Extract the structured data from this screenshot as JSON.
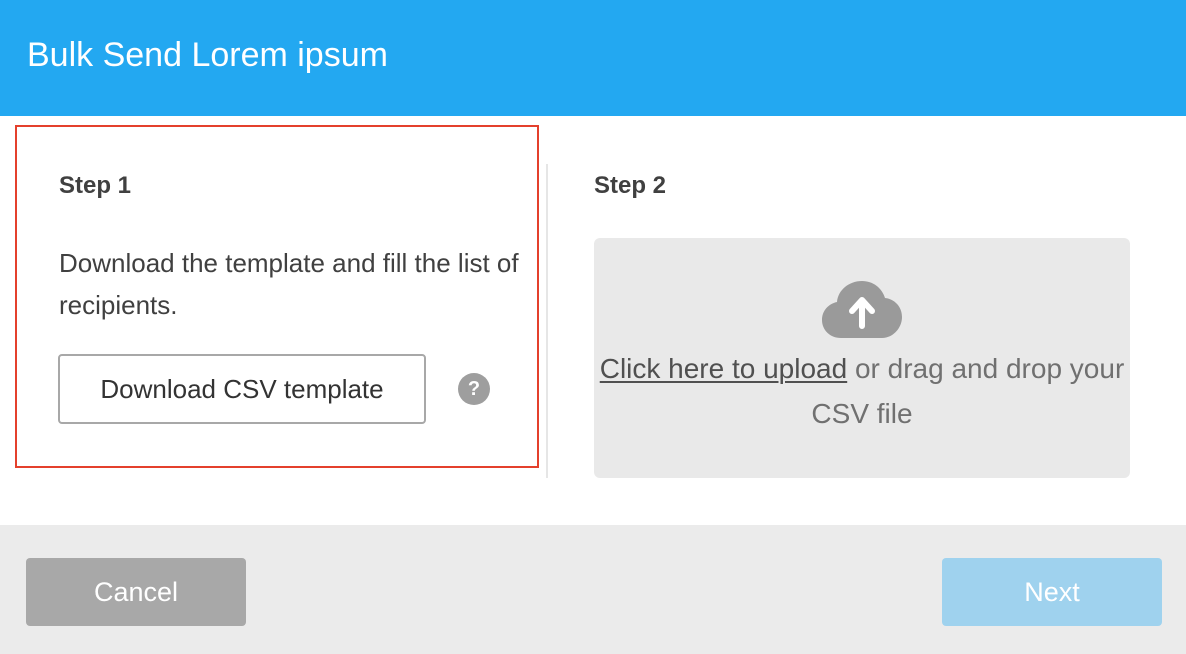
{
  "header": {
    "title": "Bulk Send Lorem ipsum"
  },
  "step1": {
    "title": "Step 1",
    "description": "Download the template and fill the list of recipients.",
    "download_button_label": "Download CSV template",
    "help_icon_glyph": "?",
    "icon": "question-circle-icon"
  },
  "step2": {
    "title": "Step 2",
    "upload_link_text": "Click here to upload",
    "upload_rest_text": " or drag and drop your CSV file",
    "icon": "cloud-upload-icon"
  },
  "footer": {
    "cancel_label": "Cancel",
    "next_label": "Next",
    "next_enabled": false
  },
  "colors": {
    "header": "#23a8f1",
    "step1_highlight_border": "#e4402c",
    "cancel_button": "#a8a8a8",
    "next_button_disabled": "#9fd2ee",
    "upload_zone": "#e9e9e9"
  }
}
